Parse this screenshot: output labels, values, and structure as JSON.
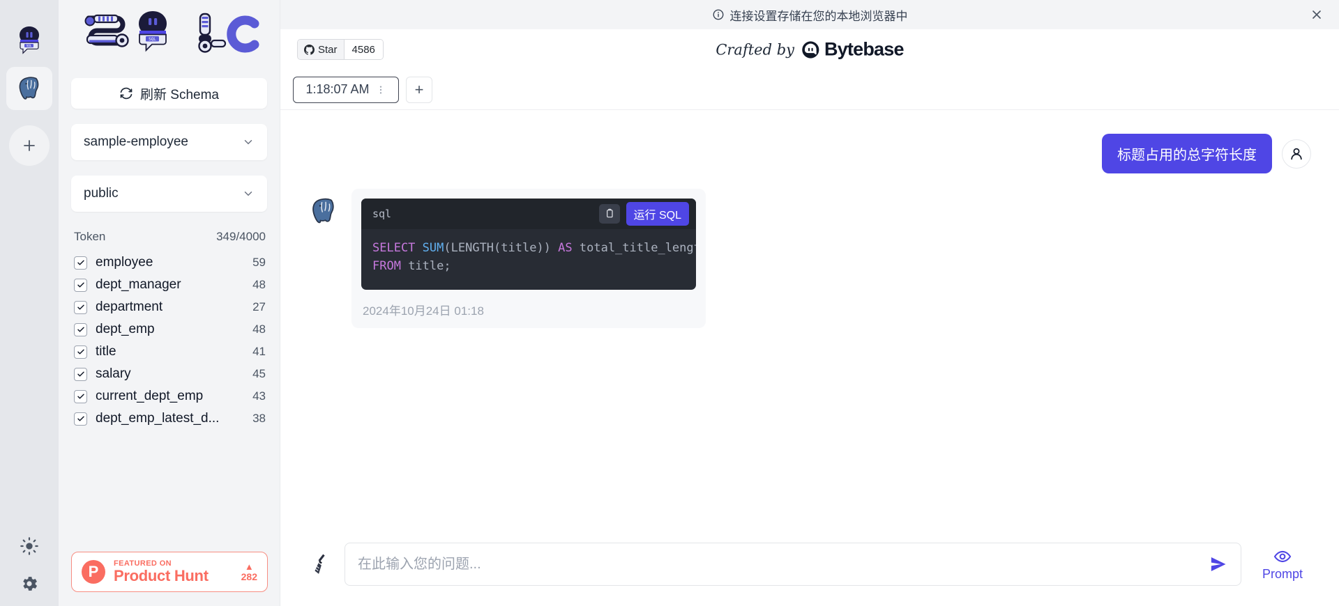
{
  "notice": {
    "icon": "info-circle-icon",
    "text": "连接设置存储在您的本地浏览器中",
    "close_icon": "close-icon"
  },
  "rail": {
    "items": [
      {
        "name": "sql-chat-logo-icon",
        "label": "SQL Chat"
      },
      {
        "name": "postgres-connection-icon",
        "label": "PostgreSQL",
        "active": true
      }
    ],
    "add_label": "+",
    "bottom": [
      {
        "name": "theme-toggle-icon",
        "label": "Theme"
      },
      {
        "name": "settings-gear-icon",
        "label": "Settings"
      }
    ]
  },
  "sidebar": {
    "brand_logo": "sql-chat-wordmark",
    "refresh_label": "刷新 Schema",
    "refresh_icon": "refresh-icon",
    "database_value": "sample-employee",
    "schema_value": "public",
    "token_label": "Token",
    "token_value": "349/4000",
    "tables": [
      {
        "name": "employee",
        "count": "59",
        "checked": true
      },
      {
        "name": "dept_manager",
        "count": "48",
        "checked": true
      },
      {
        "name": "department",
        "count": "27",
        "checked": true
      },
      {
        "name": "dept_emp",
        "count": "48",
        "checked": true
      },
      {
        "name": "title",
        "count": "41",
        "checked": true
      },
      {
        "name": "salary",
        "count": "45",
        "checked": true
      },
      {
        "name": "current_dept_emp",
        "count": "43",
        "checked": true
      },
      {
        "name": "dept_emp_latest_d...",
        "count": "38",
        "checked": true
      }
    ],
    "product_hunt": {
      "badge_letter": "P",
      "featured_text": "FEATURED ON",
      "title": "Product Hunt",
      "caret": "▲",
      "votes": "282"
    }
  },
  "topbar": {
    "github_label": "Star",
    "github_count": "4586",
    "crafted_by": "Crafted by",
    "brand": "Bytebase"
  },
  "tabs": {
    "items": [
      {
        "label": "1:18:07 AM",
        "active": true
      }
    ],
    "add_label": "+"
  },
  "chat": {
    "user_message": "标题占用的总字符长度",
    "bot": {
      "code_lang": "sql",
      "copy_icon": "clipboard-icon",
      "run_label": "运行 SQL",
      "code_tokens": [
        {
          "t": "SELECT",
          "c": "kw"
        },
        {
          "t": " ",
          "c": "pl"
        },
        {
          "t": "SUM",
          "c": "fn"
        },
        {
          "t": "(LENGTH(title)) ",
          "c": "pl"
        },
        {
          "t": "AS",
          "c": "kw"
        },
        {
          "t": " total_title_length\n",
          "c": "pl"
        },
        {
          "t": "FROM",
          "c": "kw"
        },
        {
          "t": " title;",
          "c": "pl"
        }
      ],
      "timestamp": "2024年10月24日 01:18"
    }
  },
  "composer": {
    "broom_icon": "broom-icon",
    "placeholder": "在此输入您的问题...",
    "value": "",
    "send_icon": "send-icon",
    "prompt_icon": "eye-icon",
    "prompt_label": "Prompt"
  },
  "colors": {
    "accent": "#4f46e5",
    "sidebar_bg": "#f3f4f6",
    "rail_bg": "#e5e7eb",
    "code_bg": "#282c34",
    "product_hunt": "#fa6d61"
  }
}
